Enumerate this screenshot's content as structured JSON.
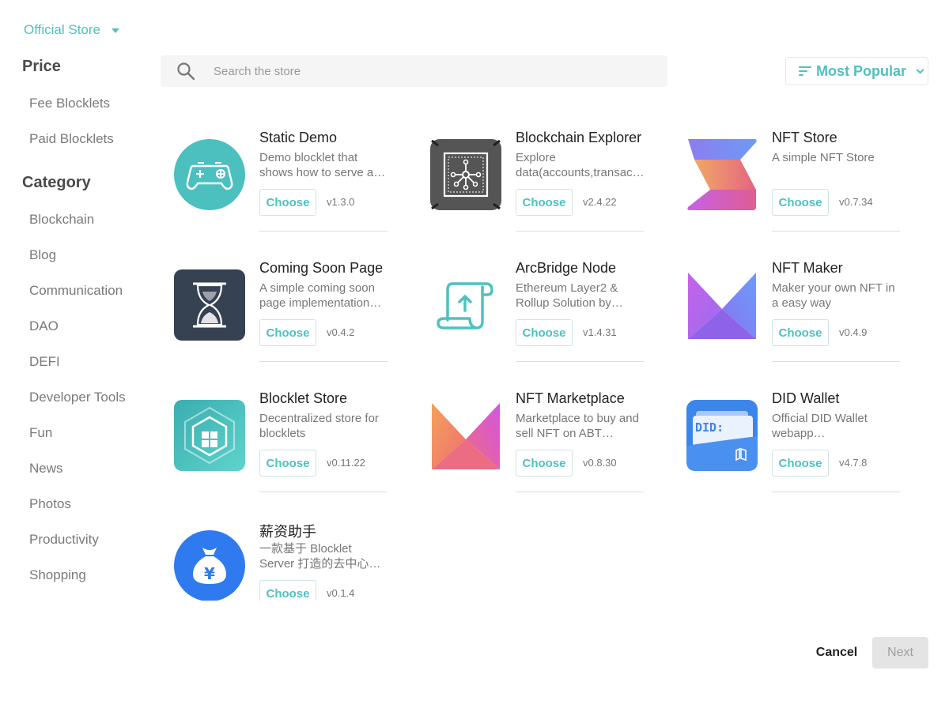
{
  "store_selector": {
    "label": "Official Store"
  },
  "sidebar": {
    "price_heading": "Price",
    "price_items": [
      "Fee Blocklets",
      "Paid Blocklets"
    ],
    "category_heading": "Category",
    "category_items": [
      "Blockchain",
      "Blog",
      "Communication",
      "DAO",
      "DEFI",
      "Developer Tools",
      "Fun",
      "News",
      "Photos",
      "Productivity",
      "Shopping"
    ]
  },
  "search": {
    "placeholder": "Search the store",
    "value": ""
  },
  "sort": {
    "label": "Most Popular"
  },
  "choose_label": "Choose",
  "cards": [
    {
      "name": "Static Demo",
      "desc": "Demo blocklet that shows how to serve a…",
      "version": "v1.3.0",
      "icon": "gamepad-icon"
    },
    {
      "name": "Blockchain Explorer",
      "desc": "Explore data(accounts,transac…",
      "version": "v2.4.22",
      "icon": "network-node-icon"
    },
    {
      "name": "NFT Store",
      "desc": "A simple NFT Store",
      "version": "v0.7.34",
      "icon": "nft-store-logo-icon"
    },
    {
      "name": "Coming Soon Page",
      "desc": "A simple coming soon page implementation…",
      "version": "v0.4.2",
      "icon": "hourglass-icon"
    },
    {
      "name": "ArcBridge Node",
      "desc": "Ethereum Layer2 & Rollup Solution by…",
      "version": "v1.4.31",
      "icon": "scroll-upload-icon"
    },
    {
      "name": "NFT Maker",
      "desc": "Maker your own NFT in a easy way",
      "version": "v0.4.9",
      "icon": "nft-maker-logo-icon"
    },
    {
      "name": "Blocklet Store",
      "desc": "Decentralized store for blocklets",
      "version": "v0.11.22",
      "icon": "blocklet-store-icon"
    },
    {
      "name": "NFT Marketplace",
      "desc": "Marketplace to buy and sell NFT on ABT…",
      "version": "v0.8.30",
      "icon": "nft-marketplace-logo-icon"
    },
    {
      "name": "DID Wallet",
      "desc": "Official DID Wallet webapp…",
      "version": "v4.7.8",
      "icon": "did-wallet-icon"
    },
    {
      "name": "薪资助手",
      "desc": "一款基于 Blocklet Server 打造的去中心…",
      "version": "v0.1.4",
      "icon": "money-bag-icon"
    }
  ],
  "footer": {
    "cancel_label": "Cancel",
    "next_label": "Next"
  },
  "colors": {
    "accent": "#4ec1c0",
    "next_disabled_bg": "#e4e4e4"
  }
}
